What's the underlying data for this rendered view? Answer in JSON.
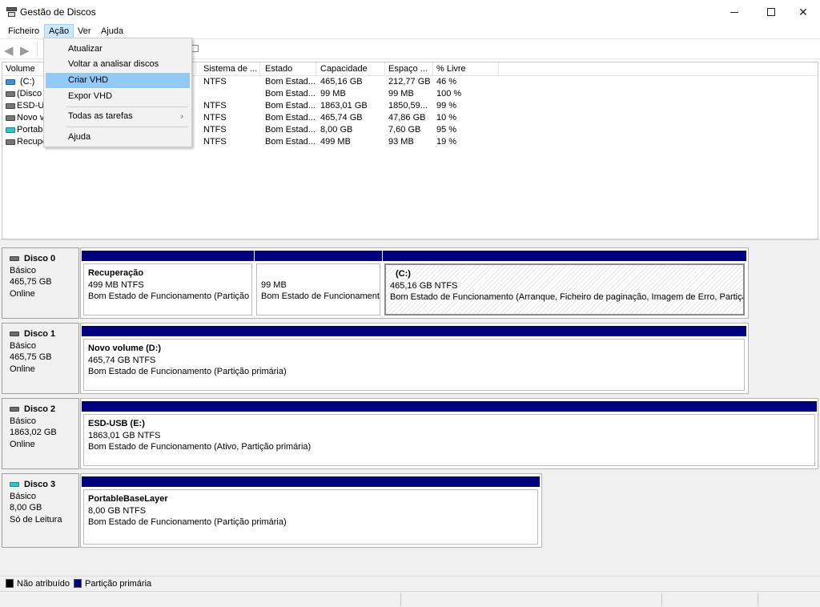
{
  "window": {
    "title": "Gestão de Discos"
  },
  "menubar": {
    "items": [
      "Ficheiro",
      "Ação",
      "Ver",
      "Ajuda"
    ]
  },
  "dropdown": {
    "items": [
      "Atualizar",
      "Voltar a analisar discos",
      "Criar VHD",
      "Expor VHD",
      "Todas as tarefas",
      "Ajuda"
    ],
    "submenu_arrow": "›"
  },
  "volume_list": {
    "columns": [
      "Volume",
      "Sistema de ...",
      "Estado",
      "Capacidade",
      "Espaço ...",
      "% Livre"
    ],
    "rows": [
      {
        "volume": "(C:)",
        "fs": "NTFS",
        "status": "Bom Estad...",
        "capacity": "465,16 GB",
        "free": "212,77 GB",
        "pct": "46 %",
        "icon": "blue-volume-icon"
      },
      {
        "volume": "(Disco",
        "fs": "",
        "status": "Bom Estad...",
        "capacity": "99 MB",
        "free": "99 MB",
        "pct": "100 %",
        "icon": "gray-volume-icon"
      },
      {
        "volume": "ESD-US",
        "fs": "NTFS",
        "status": "Bom Estad...",
        "capacity": "1863,01 GB",
        "free": "1850,59...",
        "pct": "99 %",
        "icon": "gray-volume-icon"
      },
      {
        "volume": "Novo v",
        "fs": "NTFS",
        "status": "Bom Estad...",
        "capacity": "465,74 GB",
        "free": "47,86 GB",
        "pct": "10 %",
        "icon": "gray-volume-icon"
      },
      {
        "volume": "Portabl",
        "fs": "NTFS",
        "status": "Bom Estad...",
        "capacity": "8,00 GB",
        "free": "7,60 GB",
        "pct": "95 %",
        "icon": "cyan-volume-icon"
      },
      {
        "volume": "Recupe",
        "fs": "NTFS",
        "status": "Bom Estad...",
        "capacity": "499 MB",
        "free": "93 MB",
        "pct": "19 %",
        "icon": "gray-volume-icon"
      }
    ]
  },
  "disks": [
    {
      "name": "Disco 0",
      "type": "Básico",
      "size": "465,75 GB",
      "state": "Online",
      "partitions": [
        {
          "title": "Recuperação",
          "size": "499 MB NTFS",
          "status": "Bom Estado de Funcionamento (Partição C"
        },
        {
          "title": "",
          "size": "99 MB",
          "status": "Bom Estado de Funcionamento"
        },
        {
          "title": "(C:)",
          "size": "465,16 GB NTFS",
          "status": "Bom Estado de Funcionamento (Arranque, Ficheiro de paginação, Imagem de Erro, Partição p"
        }
      ]
    },
    {
      "name": "Disco 1",
      "type": "Básico",
      "size": "465,75 GB",
      "state": "Online",
      "partitions": [
        {
          "title": "Novo volume  (D:)",
          "size": "465,74 GB NTFS",
          "status": "Bom Estado de Funcionamento (Partição primária)"
        }
      ]
    },
    {
      "name": "Disco 2",
      "type": "Básico",
      "size": "1863,02 GB",
      "state": "Online",
      "partitions": [
        {
          "title": "ESD-USB  (E:)",
          "size": "1863,01 GB NTFS",
          "status": "Bom Estado de Funcionamento (Ativo, Partição primária)"
        }
      ]
    },
    {
      "name": "Disco 3",
      "type": "Básico",
      "size": "8,00 GB",
      "state": "Só de Leitura",
      "partitions": [
        {
          "title": "PortableBaseLayer",
          "size": "8,00 GB NTFS",
          "status": "Bom Estado de Funcionamento (Partição primária)"
        }
      ]
    }
  ],
  "legend": {
    "items": [
      {
        "label": "Não atribuído",
        "color": "#000000"
      },
      {
        "label": "Partição primária",
        "color": "#00007f"
      }
    ]
  },
  "colors": {
    "partition_bar": "#00007f",
    "menu_highlight": "#91c9f7",
    "menu_active": "#cce8ff"
  }
}
